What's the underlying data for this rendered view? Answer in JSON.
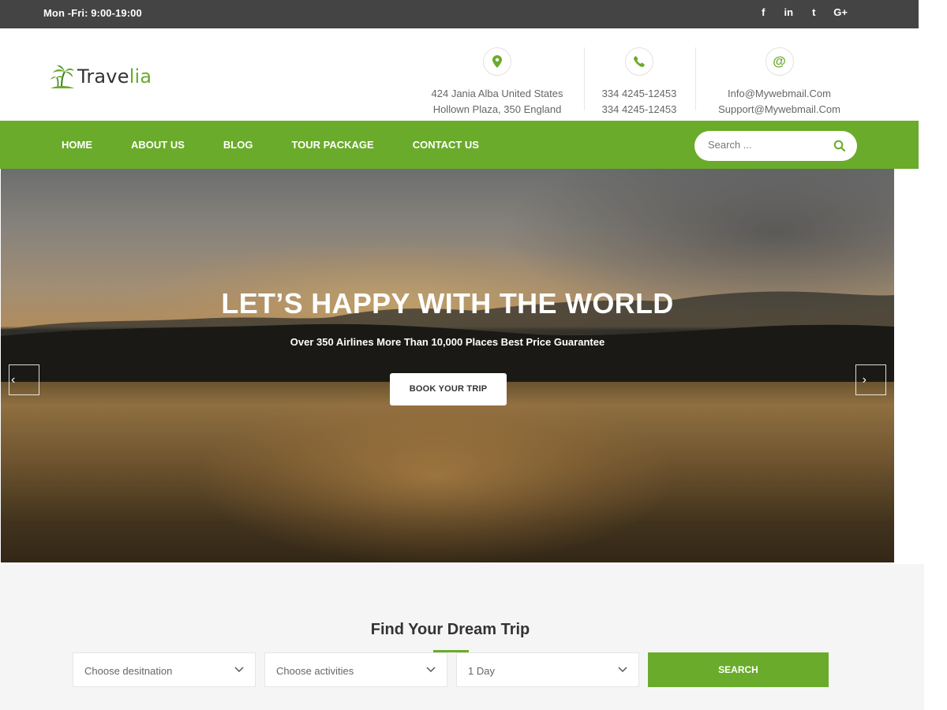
{
  "topbar": {
    "hours": "Mon -Fri: 9:00-19:00",
    "social": [
      {
        "icon": "facebook-icon",
        "glyph": "f"
      },
      {
        "icon": "linkedin-icon",
        "glyph": "in"
      },
      {
        "icon": "twitter-icon",
        "glyph": "t"
      },
      {
        "icon": "google-plus-icon",
        "glyph": "G+"
      }
    ]
  },
  "header": {
    "logo": {
      "part1": "Trave",
      "part2": "lia"
    },
    "contacts": {
      "address": {
        "icon": "map-pin-icon",
        "line1": "424 Jania Alba United States",
        "line2": "Hollown Plaza, 350 England"
      },
      "phone": {
        "icon": "phone-icon",
        "line1": "334 4245-12453",
        "line2": "334 4245-12453"
      },
      "email": {
        "icon": "at-icon",
        "glyph": "@",
        "line1": "Info@Mywebmail.Com",
        "line2": "Support@Mywebmail.Com"
      }
    }
  },
  "nav": {
    "items": [
      "HOME",
      "ABOUT US",
      "BLOG",
      "TOUR PACKAGE",
      "CONTACT US"
    ],
    "search_placeholder": "Search ..."
  },
  "hero": {
    "title": "LET’S HAPPY WITH THE WORLD",
    "subtitle": "Over 350 Airlines More Than 10,000 Places Best Price Guarantee",
    "button": "BOOK YOUR TRIP",
    "prev_glyph": "‹",
    "next_glyph": "›"
  },
  "finder": {
    "title": "Find Your Dream Trip",
    "destination": "Choose desitnation",
    "activities": "Choose activities",
    "duration": "1 Day",
    "button": "SEARCH"
  },
  "colors": {
    "accent": "#6aab2b",
    "topbar": "#444444"
  }
}
